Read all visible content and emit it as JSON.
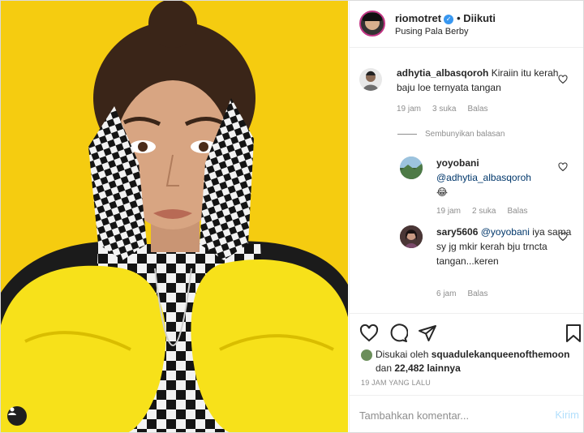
{
  "header": {
    "username": "riomotret",
    "verified_icon": "verified-check-icon",
    "follow_status": "• Diikuti",
    "location": "Pusing Pala Berby"
  },
  "comments": [
    {
      "username": "adhytia_albasqoroh",
      "text": "Kiraiin itu kerah baju loe ternyata tangan",
      "time": "19 jam",
      "likes": "3 suka",
      "reply": "Balas"
    }
  ],
  "hide_replies": "Sembunyikan balasan",
  "replies": [
    {
      "username": "yoyobani",
      "mention": "@adhytia_albasqoroh",
      "text": "😂",
      "time": "19 jam",
      "likes": "2 suka",
      "reply": "Balas"
    },
    {
      "username": "sary5606",
      "mention": "@yoyobani",
      "text": "iya sama sy jg mkir kerah bju trncta tangan...keren",
      "time": "6 jam",
      "reply": "Balas"
    }
  ],
  "likes": {
    "prefix": "Disukai oleh",
    "user": "squadulekanqueenofthemoon",
    "middle": "dan",
    "count": "22,482 lainnya"
  },
  "timestamp": "19 JAM YANG LALU",
  "add_comment": {
    "placeholder": "Tambahkan komentar...",
    "post_label": "Kirim"
  },
  "colors": {
    "photo_bg": "#f5cc10",
    "verified": "#3897f0",
    "link": "#00376b",
    "post_btn_disabled": "#b2dffc"
  }
}
